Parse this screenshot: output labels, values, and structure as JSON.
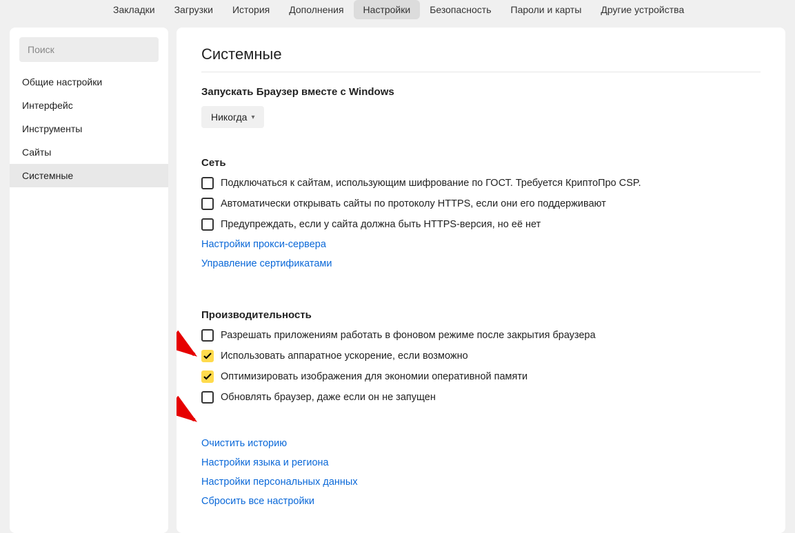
{
  "topNav": {
    "items": [
      {
        "label": "Закладки",
        "active": false
      },
      {
        "label": "Загрузки",
        "active": false
      },
      {
        "label": "История",
        "active": false
      },
      {
        "label": "Дополнения",
        "active": false
      },
      {
        "label": "Настройки",
        "active": true
      },
      {
        "label": "Безопасность",
        "active": false
      },
      {
        "label": "Пароли и карты",
        "active": false
      },
      {
        "label": "Другие устройства",
        "active": false
      }
    ]
  },
  "sidebar": {
    "searchPlaceholder": "Поиск",
    "items": [
      {
        "label": "Общие настройки",
        "active": false
      },
      {
        "label": "Интерфейс",
        "active": false
      },
      {
        "label": "Инструменты",
        "active": false
      },
      {
        "label": "Сайты",
        "active": false
      },
      {
        "label": "Системные",
        "active": true
      }
    ]
  },
  "main": {
    "title": "Системные",
    "startup": {
      "title": "Запускать Браузер вместе с Windows",
      "dropdownValue": "Никогда"
    },
    "network": {
      "title": "Сеть",
      "checks": [
        {
          "label": "Подключаться к сайтам, использующим шифрование по ГОСТ. Требуется КриптоПро CSP.",
          "checked": false
        },
        {
          "label": "Автоматически открывать сайты по протоколу HTTPS, если они его поддерживают",
          "checked": false
        },
        {
          "label": "Предупреждать, если у сайта должна быть HTTPS-версия, но её нет",
          "checked": false
        }
      ],
      "links": [
        {
          "label": "Настройки прокси-сервера"
        },
        {
          "label": "Управление сертификатами"
        }
      ]
    },
    "performance": {
      "title": "Производительность",
      "checks": [
        {
          "label": "Разрешать приложениям работать в фоновом режиме после закрытия браузера",
          "checked": false
        },
        {
          "label": "Использовать аппаратное ускорение, если возможно",
          "checked": true
        },
        {
          "label": "Оптимизировать изображения для экономии оперативной памяти",
          "checked": true
        },
        {
          "label": "Обновлять браузер, даже если он не запущен",
          "checked": false
        }
      ]
    },
    "bottomLinks": [
      {
        "label": "Очистить историю"
      },
      {
        "label": "Настройки языка и региона"
      },
      {
        "label": "Настройки персональных данных"
      },
      {
        "label": "Сбросить все настройки"
      }
    ]
  }
}
